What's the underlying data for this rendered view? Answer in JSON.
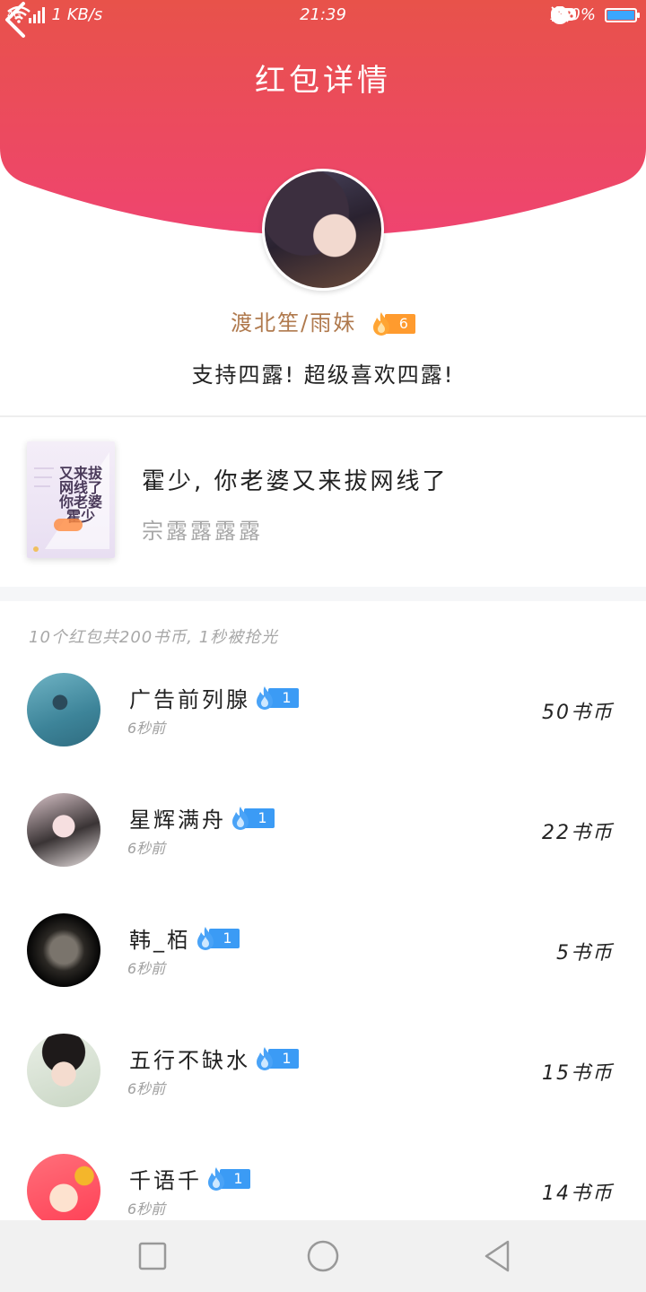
{
  "status_bar": {
    "network": "4G",
    "speed": "1 KB/s",
    "time": "21:39",
    "battery": "100%"
  },
  "header": {
    "title": "红包详情",
    "gradient_top": "#e8524a",
    "gradient_bottom": "#ee4470"
  },
  "sender": {
    "name": "渡北笙/雨妹",
    "level": "6",
    "blessing": "支持四露! 超级喜欢四露!"
  },
  "book": {
    "cover_text": "又来拔网线了你老婆霍少",
    "title": "霍少, 你老婆又来拔网线了",
    "author": "宗露露露露"
  },
  "summary": "10个红包共200书币, 1秒被抢光",
  "records": [
    {
      "name": "广告前列腺",
      "level": "1",
      "time": "6秒前",
      "amount": "50书币"
    },
    {
      "name": "星辉满舟",
      "level": "1",
      "time": "6秒前",
      "amount": "22书币"
    },
    {
      "name": "韩_栢",
      "level": "1",
      "time": "6秒前",
      "amount": "5书币"
    },
    {
      "name": "五行不缺水",
      "level": "1",
      "time": "6秒前",
      "amount": "15书币"
    },
    {
      "name": "千语千",
      "level": "1",
      "time": "6秒前",
      "amount": "14书币"
    }
  ]
}
